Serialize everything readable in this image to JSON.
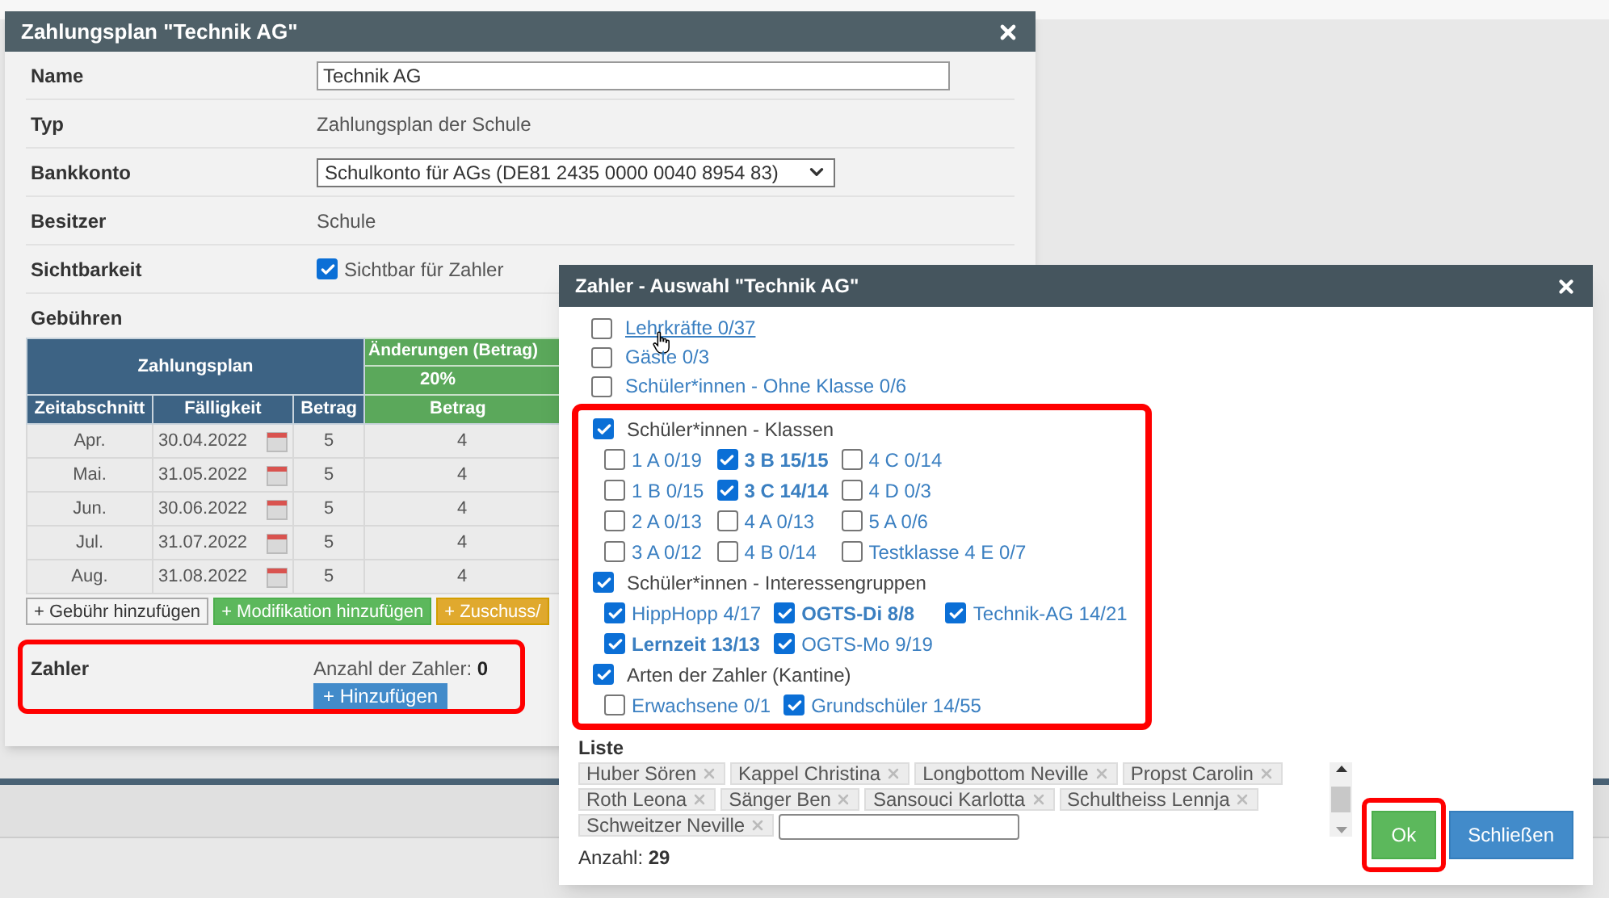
{
  "plan_window": {
    "title": "Zahlungsplan \"Technik AG\"",
    "fields": [
      {
        "label": "Name",
        "kind": "input",
        "value": "Technik AG"
      },
      {
        "label": "Typ",
        "kind": "text",
        "value": "Zahlungsplan der Schule"
      },
      {
        "label": "Bankkonto",
        "kind": "select",
        "value": "Schulkonto für AGs (DE81 2435 0000 0040 8954 83)"
      },
      {
        "label": "Besitzer",
        "kind": "text",
        "value": "Schule"
      },
      {
        "label": "Sichtbarkeit",
        "kind": "checkbox",
        "value": "Sichtbar für Zahler",
        "checked": true
      }
    ],
    "fees": {
      "label": "Gebühren",
      "plan_header": "Zahlungsplan",
      "change_header": "Änderungen (Betrag)",
      "change_percent": "20%",
      "columns": [
        "Zeitabschnitt",
        "Fälligkeit",
        "Betrag",
        "Betrag"
      ],
      "rows": [
        [
          "Apr.",
          "30.04.2022",
          "5",
          "4"
        ],
        [
          "Mai.",
          "31.05.2022",
          "5",
          "4"
        ],
        [
          "Jun.",
          "30.06.2022",
          "5",
          "4"
        ],
        [
          "Jul.",
          "31.07.2022",
          "5",
          "4"
        ],
        [
          "Aug.",
          "31.08.2022",
          "5",
          "4"
        ]
      ],
      "buttons": [
        {
          "label": "+ Gebühr hinzufügen",
          "kind": "default"
        },
        {
          "label": "+ Modifikation hinzufügen",
          "kind": "success"
        },
        {
          "label": "+ Zuschuss/",
          "kind": "warning"
        }
      ]
    },
    "payers": {
      "label": "Zahler",
      "count_label": "Anzahl der Zahler:",
      "count": "0",
      "add_button": "+ Hinzufügen",
      "highlighted": true
    }
  },
  "dialog": {
    "title": "Zahler - Auswahl \"Technik AG\"",
    "options": [
      {
        "label": "Lehrkräfte 0/37",
        "checked": false,
        "hovered": true
      },
      {
        "label": "Gäste 0/3",
        "checked": false,
        "hovered": false
      },
      {
        "label": "Schüler*innen - Ohne Klasse 0/6",
        "checked": false,
        "hovered": false
      }
    ],
    "groups": {
      "highlighted": true,
      "items": [
        {
          "label": "Schüler*innen - Klassen",
          "checked": true,
          "rows": [
            [
              {
                "label": "1 A 0/19",
                "checked": false,
                "complete": false
              },
              {
                "label": "3 B 15/15",
                "checked": true,
                "complete": true
              },
              {
                "label": "4 C 0/14",
                "checked": false,
                "complete": false
              }
            ],
            [
              {
                "label": "1 B 0/15",
                "checked": false,
                "complete": false
              },
              {
                "label": "3 C 14/14",
                "checked": true,
                "complete": true
              },
              {
                "label": "4 D 0/3",
                "checked": false,
                "complete": false
              }
            ],
            [
              {
                "label": "2 A 0/13",
                "checked": false,
                "complete": false
              },
              {
                "label": "4 A 0/13",
                "checked": false,
                "complete": false
              },
              {
                "label": "5 A 0/6",
                "checked": false,
                "complete": false
              }
            ],
            [
              {
                "label": "3 A 0/12",
                "checked": false,
                "complete": false
              },
              {
                "label": "4 B 0/14",
                "checked": false,
                "complete": false
              },
              {
                "label": "Testklasse 4 E 0/7",
                "checked": false,
                "complete": false
              }
            ]
          ]
        },
        {
          "label": "Schüler*innen - Interessengruppen",
          "checked": true,
          "rows": [
            [
              {
                "label": "HippHopp 4/17",
                "checked": true,
                "complete": false
              },
              {
                "label": "OGTS-Di 8/8",
                "checked": true,
                "complete": true
              },
              {
                "label": "Technik-AG 14/21",
                "checked": true,
                "complete": false
              }
            ],
            [
              {
                "label": "Lernzeit 13/13",
                "checked": true,
                "complete": true
              },
              {
                "label": "OGTS-Mo 9/19",
                "checked": true,
                "complete": false
              }
            ]
          ]
        },
        {
          "label": "Arten der Zahler (Kantine)",
          "checked": true,
          "rows": [
            [
              {
                "label": "Erwachsene 0/1",
                "checked": false,
                "complete": false
              },
              {
                "label": "Grundschüler 14/55",
                "checked": true,
                "complete": false
              }
            ]
          ]
        }
      ]
    },
    "list": {
      "label": "Liste",
      "tags": [
        "Huber Sören",
        "Kappel Christina",
        "Longbottom Neville",
        "Propst Carolin",
        "Roth Leona",
        "Sänger Ben",
        "Sansouci Karlotta",
        "Schultheiss Lennja",
        "Schweitzer Neville"
      ],
      "count_label": "Anzahl:",
      "count": "29"
    },
    "buttons": [
      {
        "label": "Ok",
        "kind": "success",
        "highlighted": true
      },
      {
        "label": "Schließen",
        "kind": "primary",
        "highlighted": false
      }
    ]
  }
}
